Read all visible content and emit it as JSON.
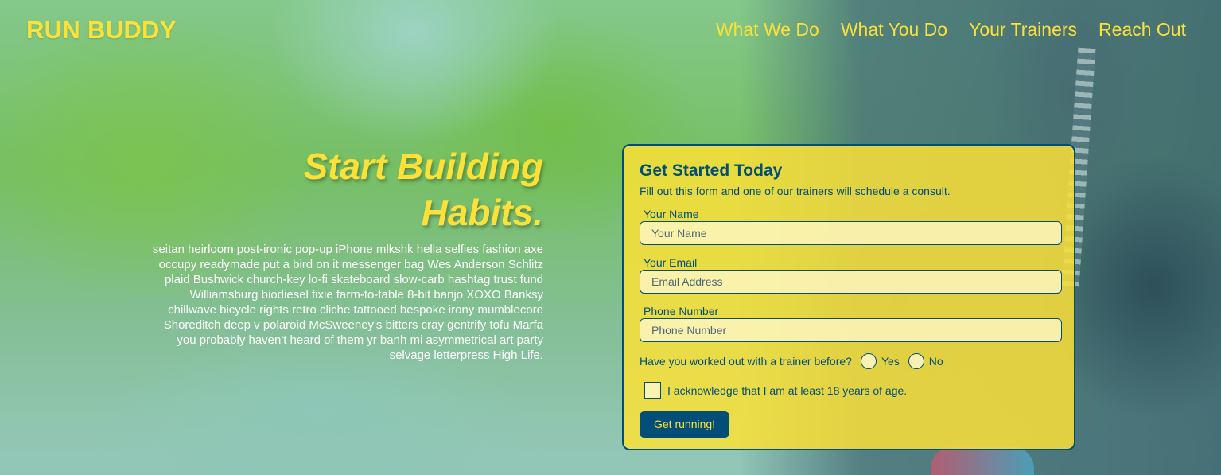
{
  "header": {
    "brand": "RUN BUDDY",
    "nav": [
      {
        "label": "What We Do"
      },
      {
        "label": "What You Do"
      },
      {
        "label": "Your Trainers"
      },
      {
        "label": "Reach Out"
      }
    ]
  },
  "intro": {
    "title_line1": "Start Building",
    "title_line2": "Habits.",
    "body": "seitan heirloom post-ironic pop-up iPhone mlkshk hella selfies fashion axe occupy readymade put a bird on it messenger bag Wes Anderson Schlitz plaid Bushwick church-key lo-fi skateboard slow-carb hashtag trust fund Williamsburg biodiesel fixie farm-to-table 8-bit banjo XOXO Banksy chillwave bicycle rights retro cliche tattooed bespoke irony mumblecore Shoreditch deep v polaroid McSweeney's bitters cray gentrify tofu Marfa you probably haven't heard of them yr banh mi asymmetrical art party selvage letterpress High Life."
  },
  "signup": {
    "title": "Get Started Today",
    "subtitle": "Fill out this form and one of our trainers will schedule a consult.",
    "name_label": "Your Name",
    "name_placeholder": "Your Name",
    "name_value": "",
    "email_label": "Your Email",
    "email_placeholder": "Email Address",
    "email_value": "",
    "phone_label": "Phone Number",
    "phone_placeholder": "Phone Number",
    "phone_value": "",
    "trainer_question": "Have you worked out with a trainer before?",
    "yes_label": "Yes",
    "no_label": "No",
    "yes_checked": false,
    "no_checked": false,
    "ack_label": "I acknowledge that I am at least 18 years of age.",
    "ack_checked": false,
    "submit_label": "Get running!"
  },
  "colors": {
    "accent": "#fce138",
    "primary": "#024e76"
  }
}
